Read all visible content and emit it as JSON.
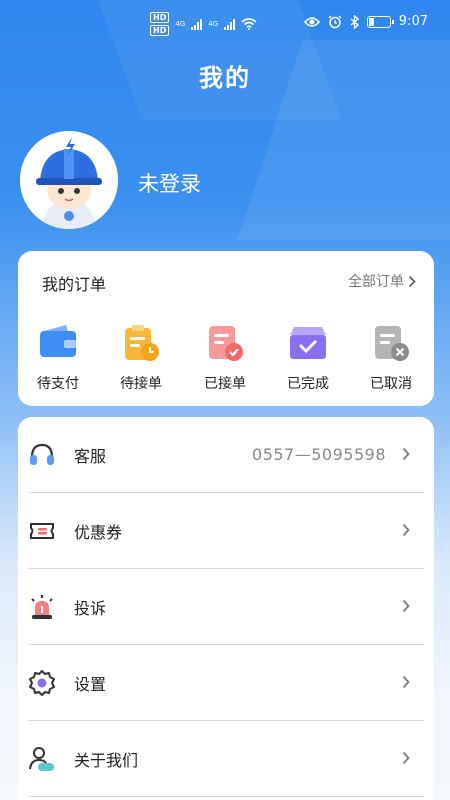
{
  "status_bar": {
    "left_badges": [
      "HD",
      "HD"
    ],
    "network": [
      "4G",
      "4G"
    ],
    "time": "9:07"
  },
  "header": {
    "title": "我的"
  },
  "profile": {
    "login_text": "未登录"
  },
  "orders": {
    "title": "我的订单",
    "all_label": "全部订单",
    "items": [
      {
        "label": "待支付",
        "icon": "wallet-icon",
        "color": "#3e8ef5"
      },
      {
        "label": "待接单",
        "icon": "clipboard-clock-icon",
        "color": "#f5b83d"
      },
      {
        "label": "已接单",
        "icon": "document-check-icon",
        "color": "#f27373"
      },
      {
        "label": "已完成",
        "icon": "box-check-icon",
        "color": "#8a6ff0"
      },
      {
        "label": "已取消",
        "icon": "document-cancel-icon",
        "color": "#9a9a9a"
      }
    ]
  },
  "menu": [
    {
      "label": "客服",
      "value": "0557—5095598",
      "icon": "headset-icon"
    },
    {
      "label": "优惠券",
      "value": "",
      "icon": "coupon-icon"
    },
    {
      "label": "投诉",
      "value": "",
      "icon": "alarm-icon"
    },
    {
      "label": "设置",
      "value": "",
      "icon": "gear-icon"
    },
    {
      "label": "关于我们",
      "value": "",
      "icon": "user-info-icon"
    }
  ],
  "colors": {
    "primary": "#2f86ee",
    "accent_red": "#f06a6a",
    "accent_teal": "#5ec7c9"
  }
}
